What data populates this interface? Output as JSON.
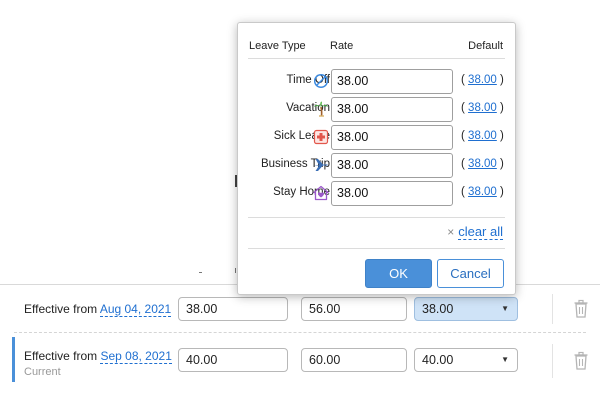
{
  "popup": {
    "headers": {
      "leave_type": "Leave Type",
      "rate": "Rate",
      "default": "Default"
    },
    "leave_types": [
      {
        "name": "Time Off",
        "icon": "prohibited-icon",
        "rate": "38.00",
        "default": "38.00"
      },
      {
        "name": "Vacation",
        "icon": "palm-tree-icon",
        "rate": "38.00",
        "default": "38.00"
      },
      {
        "name": "Sick Leave",
        "icon": "medical-cross-icon",
        "rate": "38.00",
        "default": "38.00"
      },
      {
        "name": "Business Trip",
        "icon": "airplane-icon",
        "rate": "38.00",
        "default": "38.00"
      },
      {
        "name": "Stay Home",
        "icon": "home-heart-icon",
        "rate": "38.00",
        "default": "38.00"
      }
    ],
    "paren_open": "(",
    "paren_close": ")",
    "clear_all": "clear all",
    "clear_icon": "×",
    "ok_label": "OK",
    "cancel_label": "Cancel"
  },
  "rates": [
    {
      "prefix": "Effective from",
      "date": "Aug 04, 2021",
      "sub": "",
      "rate": "38.00",
      "overtime": "56.00",
      "leave": "38.00"
    },
    {
      "prefix": "Effective from",
      "date": "Sep 08, 2021",
      "sub": "Current",
      "rate": "40.00",
      "overtime": "60.00",
      "leave": "40.00"
    }
  ],
  "colors": {
    "accent": "#4a90d9",
    "link": "#1f6fd0",
    "selected_bg": "#cfe3f7"
  }
}
